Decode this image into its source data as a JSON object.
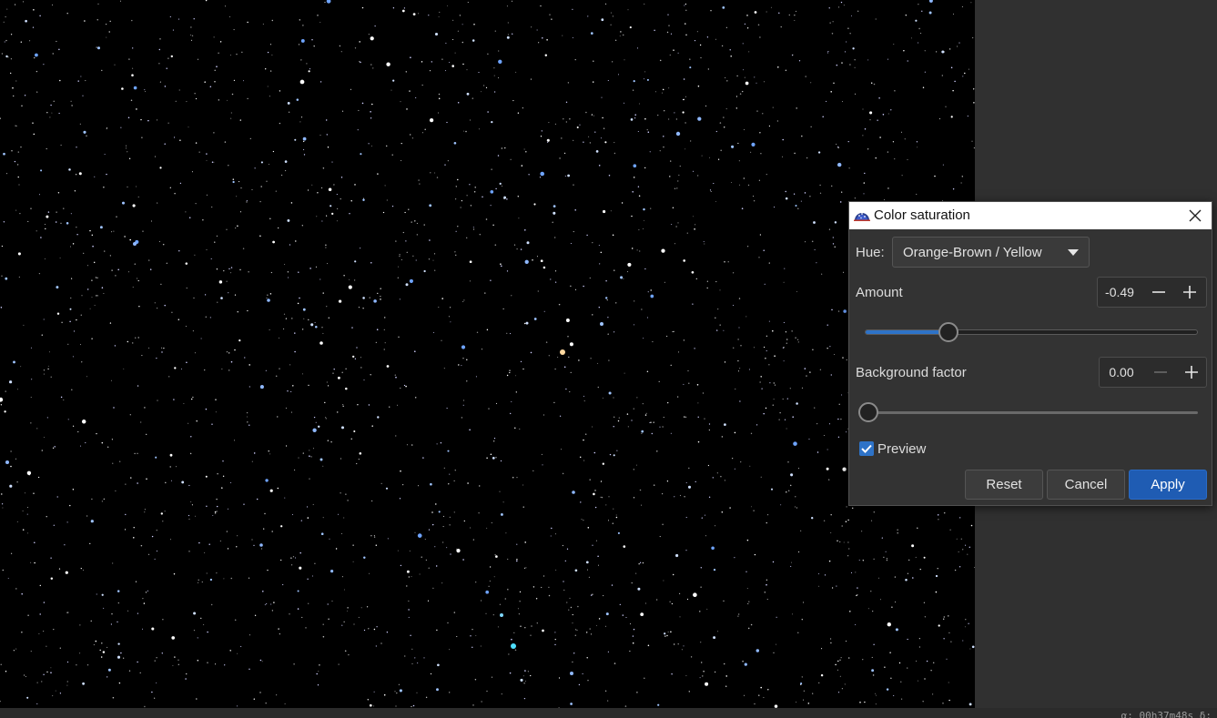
{
  "colors": {
    "accent": "#2e73c8",
    "apply_button": "#1f5cb3",
    "dialog_background": "#333333",
    "image_background": "#000000"
  },
  "image": {
    "type": "astronomical star field",
    "visible_text": ""
  },
  "status_bar": {
    "text": "α: 00h37m48s δ:"
  },
  "dialog": {
    "title": "Color saturation",
    "app_icon": "siril-app-icon",
    "close_icon": "close-icon",
    "hue": {
      "label": "Hue:",
      "selected": "Orange-Brown / Yellow",
      "dropdown_icon": "chevron-down-icon"
    },
    "amount": {
      "label": "Amount",
      "value": "-0.49",
      "slider_fraction": 0.25,
      "minus_icon": "minus-icon",
      "plus_icon": "plus-icon"
    },
    "background_factor": {
      "label": "Background factor",
      "value": "0.00",
      "slider_fraction": 0.0,
      "minus_icon": "minus-icon",
      "plus_icon": "plus-icon"
    },
    "preview": {
      "label": "Preview",
      "checked": true
    },
    "buttons": {
      "reset": "Reset",
      "cancel": "Cancel",
      "apply": "Apply"
    }
  }
}
